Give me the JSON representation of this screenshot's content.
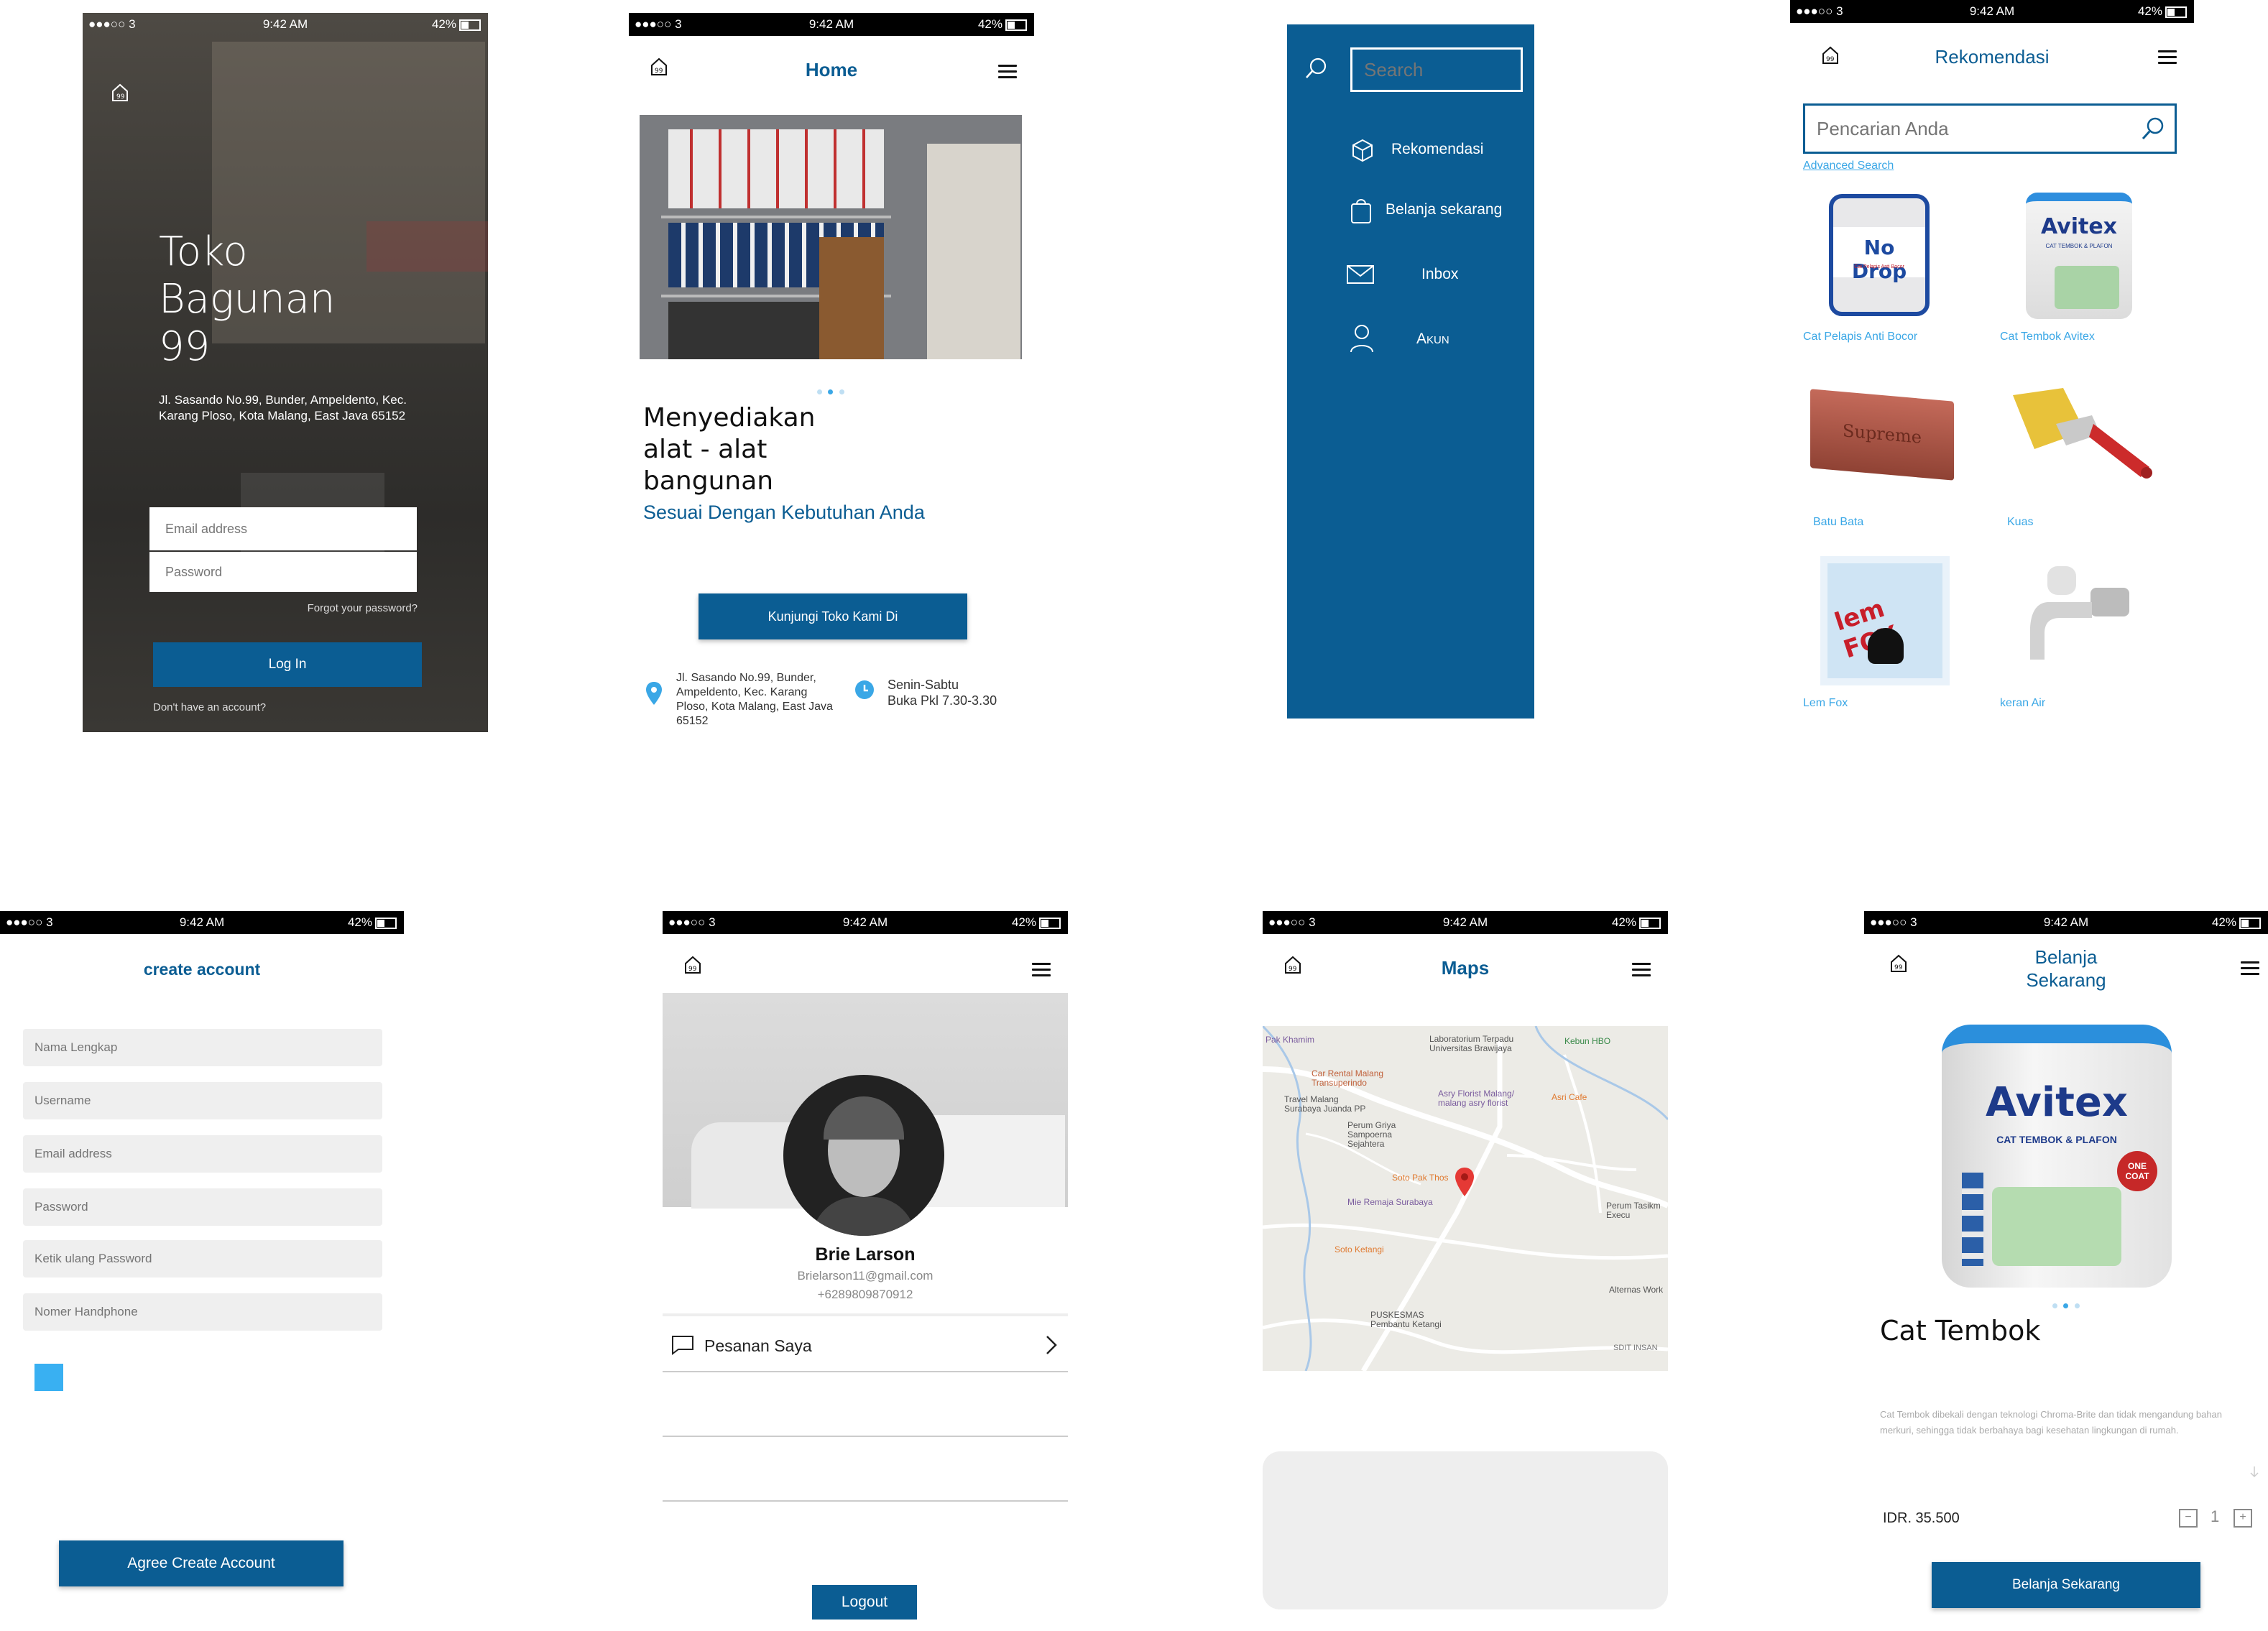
{
  "status": {
    "carrier": "●●●○○ 3",
    "time": "9:42 AM",
    "battery": "42%"
  },
  "login": {
    "title_lines": [
      "Toko",
      "Bagunan",
      "99"
    ],
    "address": "Jl. Sasando No.99, Bunder, Ampeldento, Kec. Karang Ploso, Kota Malang, East Java 65152",
    "email_placeholder": "Email address",
    "password_placeholder": "Password",
    "forgot": "Forgot your password?",
    "login_button": "Log In",
    "no_account": "Don't have an account?"
  },
  "home": {
    "title": "Home",
    "heading_lines": [
      "Menyediakan",
      "alat - alat",
      "bangunan"
    ],
    "subheading": "Sesuai Dengan Kebutuhan Anda",
    "visit_button": "Kunjungi Toko Kami Di",
    "address": "Jl. Sasando No.99, Bunder, Ampeldento, Kec. Karang Ploso, Kota Malang, East Java 65152",
    "hours_days": "Senin-Sabtu",
    "hours_time": "Buka Pkl 7.30-3.30"
  },
  "menu": {
    "search_placeholder": "Search",
    "items": [
      {
        "label": "Rekomendasi",
        "icon": "box-icon"
      },
      {
        "label": "Belanja sekarang",
        "icon": "shopping-bag-icon"
      },
      {
        "label": "Inbox",
        "icon": "mail-icon"
      },
      {
        "label": "Akun",
        "icon": "user-icon"
      }
    ]
  },
  "rekomendasi": {
    "title": "Rekomendasi",
    "search_placeholder": "Pencarian Anda",
    "advanced": "Advanced Search",
    "products": [
      {
        "label": "Cat Pelapis Anti Bocor",
        "brand": "No Drop",
        "sub": "Cat Pelapis Anti Bocor"
      },
      {
        "label": "Cat Tembok Avitex",
        "brand": "Avitex",
        "sub": "CAT TEMBOK & PLAFON"
      },
      {
        "label": "Batu Bata",
        "brand": "Supreme",
        "sub": ""
      },
      {
        "label": "Kuas",
        "brand": "",
        "sub": ""
      },
      {
        "label": "Lem Fox",
        "brand": "lem FOX",
        "sub": ""
      },
      {
        "label": "keran Air",
        "brand": "",
        "sub": ""
      }
    ]
  },
  "create": {
    "title": "create account",
    "fields": [
      "Nama Lengkap",
      "Username",
      "Email address",
      "Password",
      "Ketik ulang Password",
      "Nomer Handphone"
    ],
    "agree_button": "Agree Create Account"
  },
  "profile": {
    "name": "Brie Larson",
    "email": "Brielarson11@gmail.com",
    "phone": "+6289809870912",
    "orders": "Pesanan Saya",
    "logout": "Logout"
  },
  "maps": {
    "title": "Maps",
    "labels": [
      "Pak Khamim",
      "Laboratorium Terpadu Universitas Brawijaya",
      "Kebun HBO",
      "Car Rental Malang Transuperindo",
      "Travel Malang Surabaya Juanda PP",
      "Asry Florist Malang/ malang asry florist",
      "Asri Cafe",
      "Perum Griya Sampoerna Sejahtera",
      "Soto Pak Thos",
      "Mie Remaja Surabaya",
      "Perum Tasikm Execu",
      "Soto Ketangi",
      "PUSKESMAS Pembantu Ketangi",
      "Alternas Work",
      "SDIT INSAN"
    ]
  },
  "belanja": {
    "title_lines": [
      "Belanja",
      "Sekarang"
    ],
    "product_name": "Cat Tembok",
    "brand": "Avitex",
    "brand_sub": "CAT TEMBOK & PLAFON",
    "badge": "ONE COAT",
    "description": "Cat Tembok dibekali dengan teknologi Chroma-Brite dan tidak mengandung bahan merkuri, sehingga tidak berbahaya bagi kesehatan lingkungan di rumah.",
    "price": "IDR. 35.500",
    "qty": "1",
    "button": "Belanja Sekarang"
  },
  "colors": {
    "brand_blue": "#0b5d93",
    "light_blue": "#3aa7e6",
    "menu_blue": "#0b5d93"
  }
}
